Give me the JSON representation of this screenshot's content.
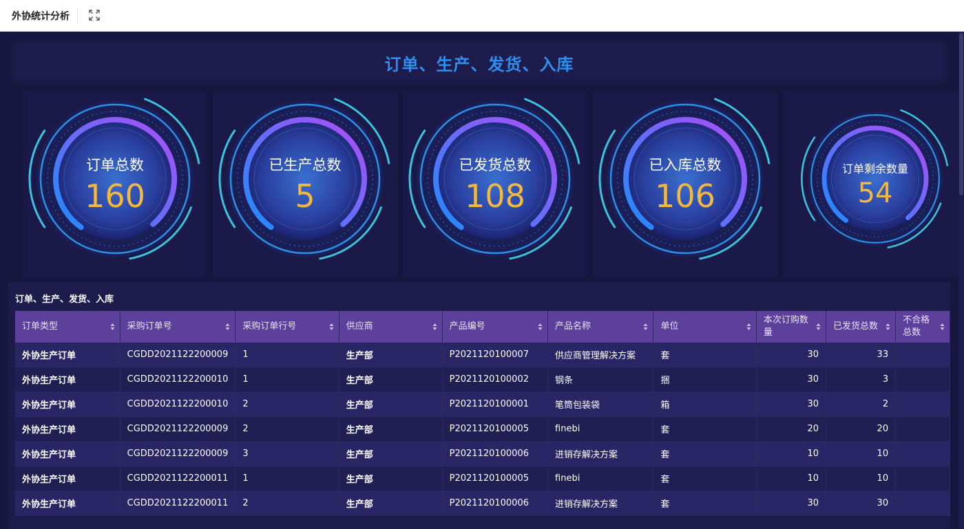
{
  "topbar": {
    "title": "外协统计分析",
    "fullscreen_icon": "expand-icon"
  },
  "header": {
    "title": "订单、生产、发货、入库"
  },
  "stats": [
    {
      "label": "订单总数",
      "value": "160"
    },
    {
      "label": "已生产总数",
      "value": "5"
    },
    {
      "label": "已发货总数",
      "value": "108"
    },
    {
      "label": "已入库总数",
      "value": "106"
    },
    {
      "label": "订单剩余数量",
      "value": "54"
    }
  ],
  "table": {
    "title": "订单、生产、发货、入库",
    "columns": [
      "订单类型",
      "采购订单号",
      "采购订单行号",
      "供应商",
      "产品编号",
      "产品名称",
      "单位",
      "本次订购数量",
      "已发货总数",
      "不合格总数"
    ],
    "rows": [
      [
        "外协生产订单",
        "CGDD2021122200009",
        "1",
        "生产部",
        "P2021120100007",
        "供应商管理解决方案",
        "套",
        "30",
        "33",
        ""
      ],
      [
        "外协生产订单",
        "CGDD2021122200010",
        "1",
        "生产部",
        "P2021120100002",
        "钢条",
        "捆",
        "30",
        "3",
        ""
      ],
      [
        "外协生产订单",
        "CGDD2021122200010",
        "2",
        "生产部",
        "P2021120100001",
        "笔筒包装袋",
        "箱",
        "30",
        "2",
        ""
      ],
      [
        "外协生产订单",
        "CGDD2021122200009",
        "2",
        "生产部",
        "P2021120100005",
        "finebi",
        "套",
        "20",
        "20",
        ""
      ],
      [
        "外协生产订单",
        "CGDD2021122200009",
        "3",
        "生产部",
        "P2021120100006",
        "进销存解决方案",
        "套",
        "10",
        "10",
        ""
      ],
      [
        "外协生产订单",
        "CGDD2021122200011",
        "1",
        "生产部",
        "P2021120100005",
        "finebi",
        "套",
        "10",
        "10",
        ""
      ],
      [
        "外协生产订单",
        "CGDD2021122200011",
        "2",
        "生产部",
        "P2021120100006",
        "进销存解决方案",
        "套",
        "30",
        "30",
        ""
      ]
    ]
  },
  "colors": {
    "background": "#16163f",
    "title_blue": "#2f8ff0",
    "value_gold": "#f3b83e",
    "header_purple": "#5d3f9c"
  }
}
